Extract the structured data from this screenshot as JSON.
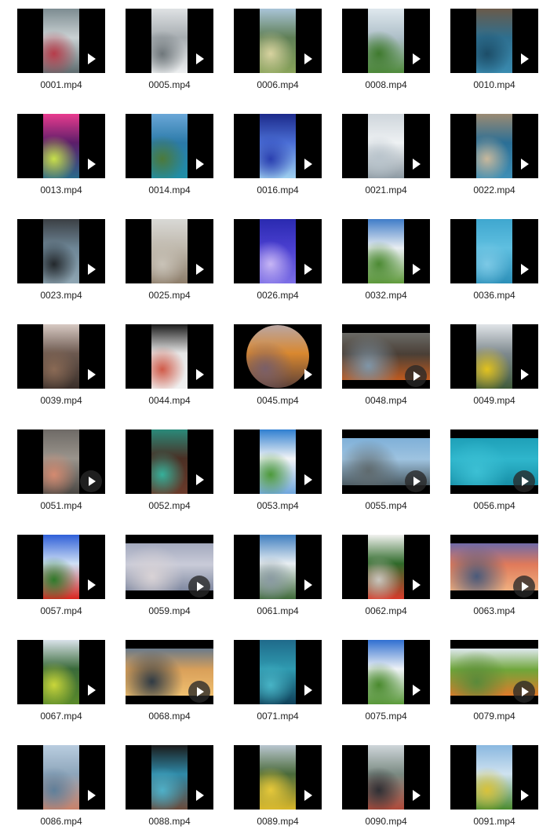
{
  "files": [
    {
      "name": "0001.mp4",
      "layout": "portrait",
      "play": "small",
      "colors": [
        "#7d8c91",
        "#c9d1d3",
        "#5e6b6e",
        "#b73c4a"
      ]
    },
    {
      "name": "0005.mp4",
      "layout": "portrait",
      "play": "small",
      "colors": [
        "#dfe2e4",
        "#a7adb1",
        "#eef0f1",
        "#6f777b"
      ]
    },
    {
      "name": "0006.mp4",
      "layout": "portrait",
      "play": "small",
      "colors": [
        "#a9c4d8",
        "#5f7f56",
        "#89a35a",
        "#d8d3a0"
      ]
    },
    {
      "name": "0008.mp4",
      "layout": "portrait",
      "play": "small",
      "colors": [
        "#dfe8ee",
        "#aebfc8",
        "#4f8a3b",
        "#3f7a2e"
      ]
    },
    {
      "name": "0010.mp4",
      "layout": "portrait",
      "play": "small",
      "colors": [
        "#6a5a4a",
        "#2e6f8f",
        "#3a8bb0",
        "#1c4d68"
      ]
    },
    {
      "name": "0013.mp4",
      "layout": "portrait",
      "play": "small",
      "colors": [
        "#e93b8f",
        "#5c1e6a",
        "#2a6a8a",
        "#c7e04a"
      ]
    },
    {
      "name": "0014.mp4",
      "layout": "portrait",
      "play": "small",
      "colors": [
        "#6aa7d8",
        "#2b7aa8",
        "#1f8fa6",
        "#4c7a3a"
      ]
    },
    {
      "name": "0016.mp4",
      "layout": "portrait",
      "play": "small",
      "colors": [
        "#1c2a8a",
        "#4b6fd6",
        "#9fd0ef",
        "#2a3fb0"
      ]
    },
    {
      "name": "0021.mp4",
      "layout": "portrait",
      "play": "small",
      "colors": [
        "#cfd6dc",
        "#eef1f3",
        "#8d9aa3",
        "#b9c4cc"
      ]
    },
    {
      "name": "0022.mp4",
      "layout": "portrait",
      "play": "small",
      "colors": [
        "#9a8a72",
        "#2b6f96",
        "#3e8fb6",
        "#c8b89c"
      ]
    },
    {
      "name": "0023.mp4",
      "layout": "portrait",
      "play": "small",
      "colors": [
        "#3b3f44",
        "#6e8696",
        "#8fa6b3",
        "#23282c"
      ]
    },
    {
      "name": "0025.mp4",
      "layout": "portrait",
      "play": "small",
      "colors": [
        "#d9d9d6",
        "#bfb8ac",
        "#8d7d6a",
        "#c9c3b8"
      ]
    },
    {
      "name": "0026.mp4",
      "layout": "portrait",
      "play": "small",
      "colors": [
        "#2a2ab0",
        "#4a3fd0",
        "#7d6fe6",
        "#c7b6f5"
      ]
    },
    {
      "name": "0032.mp4",
      "layout": "portrait",
      "play": "small",
      "colors": [
        "#3f7cc8",
        "#e9eef2",
        "#5f9a3b",
        "#4c8a33"
      ]
    },
    {
      "name": "0036.mp4",
      "layout": "portrait",
      "play": "small",
      "colors": [
        "#3fa7cf",
        "#5fbfe0",
        "#2c8fb8",
        "#7cc9e6"
      ]
    },
    {
      "name": "0039.mp4",
      "layout": "portrait",
      "play": "small",
      "colors": [
        "#d7c9c3",
        "#6d5a50",
        "#3a2f2a",
        "#8a6a55"
      ]
    },
    {
      "name": "0044.mp4",
      "layout": "portrait",
      "play": "small",
      "colors": [
        "#1a1a1a",
        "#e6e6e6",
        "#f0f0f0",
        "#d05a48"
      ]
    },
    {
      "name": "0045.mp4",
      "layout": "round",
      "play": "small",
      "colors": [
        "#b9a6a3",
        "#d9882f",
        "#5a3f38",
        "#7a5f68"
      ]
    },
    {
      "name": "0048.mp4",
      "layout": "landscape",
      "play": "circle",
      "colors": [
        "#6a6a66",
        "#4a3f36",
        "#c05a1e",
        "#7f96a8"
      ]
    },
    {
      "name": "0049.mp4",
      "layout": "portrait",
      "play": "small",
      "colors": [
        "#e0e4e8",
        "#7f8a8f",
        "#3f5a3a",
        "#e2c21e"
      ]
    },
    {
      "name": "0051.mp4",
      "layout": "portrait",
      "play": "circle",
      "colors": [
        "#6e6a66",
        "#9a948c",
        "#4a4743",
        "#d48a70"
      ]
    },
    {
      "name": "0052.mp4",
      "layout": "portrait",
      "play": "small",
      "colors": [
        "#2a8a7a",
        "#4a2f24",
        "#6a3a2a",
        "#36b09a"
      ]
    },
    {
      "name": "0053.mp4",
      "layout": "portrait",
      "play": "small",
      "colors": [
        "#2f7fd0",
        "#f2f4f6",
        "#6fa6dc",
        "#4d9a3a"
      ]
    },
    {
      "name": "0055.mp4",
      "layout": "landscape",
      "play": "circle",
      "colors": [
        "#7fb0d8",
        "#9ec3e0",
        "#4a5a62",
        "#5f6a6e"
      ]
    },
    {
      "name": "0056.mp4",
      "layout": "landscape",
      "play": "circle",
      "colors": [
        "#1fa0b8",
        "#2fb6cc",
        "#168ea6",
        "#3cc0d4"
      ]
    },
    {
      "name": "0057.mp4",
      "layout": "portrait",
      "play": "small",
      "colors": [
        "#2f5fd8",
        "#cfe0f5",
        "#d8261e",
        "#2f7a2a"
      ]
    },
    {
      "name": "0059.mp4",
      "layout": "landscape",
      "play": "circle",
      "colors": [
        "#a3a9bd",
        "#c9cbd8",
        "#7f88a0",
        "#d9d3d6"
      ]
    },
    {
      "name": "0061.mp4",
      "layout": "portrait",
      "play": "small",
      "colors": [
        "#3f7fc0",
        "#e8eef2",
        "#3f6a3a",
        "#8a9aa2"
      ]
    },
    {
      "name": "0062.mp4",
      "layout": "portrait",
      "play": "small",
      "colors": [
        "#f2f2f0",
        "#2f6a2a",
        "#d83a2a",
        "#c9c6be"
      ]
    },
    {
      "name": "0063.mp4",
      "layout": "landscape",
      "play": "circle",
      "colors": [
        "#6f6aa8",
        "#e07a5a",
        "#f0b080",
        "#4a5a7a"
      ]
    },
    {
      "name": "0067.mp4",
      "layout": "portrait",
      "play": "small",
      "colors": [
        "#d9e2ea",
        "#3a6a3a",
        "#5a8a2a",
        "#c9d63a"
      ]
    },
    {
      "name": "0068.mp4",
      "layout": "landscape",
      "play": "circle",
      "colors": [
        "#6a7a8a",
        "#d9a05a",
        "#f0c070",
        "#2f3a44"
      ]
    },
    {
      "name": "0071.mp4",
      "layout": "portrait",
      "play": "small",
      "colors": [
        "#1f6a8a",
        "#2f9ab0",
        "#0f3f58",
        "#48b4c6"
      ]
    },
    {
      "name": "0075.mp4",
      "layout": "portrait",
      "play": "small",
      "colors": [
        "#2f6fd0",
        "#eef2f6",
        "#5a9a3a",
        "#4a8a2e"
      ]
    },
    {
      "name": "0079.mp4",
      "layout": "landscape",
      "play": "circle",
      "colors": [
        "#dfe8ee",
        "#6fa63a",
        "#e07a2a",
        "#5a8a3a"
      ]
    },
    {
      "name": "0086.mp4",
      "layout": "portrait",
      "play": "small",
      "colors": [
        "#b9cde0",
        "#8ea6bb",
        "#c9826a",
        "#5f7f9a"
      ]
    },
    {
      "name": "0088.mp4",
      "layout": "portrait",
      "play": "small",
      "colors": [
        "#1a1a1a",
        "#2f8aa8",
        "#6a4a3a",
        "#4fb0c8"
      ]
    },
    {
      "name": "0089.mp4",
      "layout": "portrait",
      "play": "small",
      "colors": [
        "#b9c6d0",
        "#4a6a3a",
        "#d8b62a",
        "#e6c83a"
      ]
    },
    {
      "name": "0090.mp4",
      "layout": "portrait",
      "play": "small",
      "colors": [
        "#cfd6da",
        "#7a8a82",
        "#b04a3a",
        "#2f2f34"
      ]
    },
    {
      "name": "0091.mp4",
      "layout": "portrait",
      "play": "small",
      "colors": [
        "#8ab8e0",
        "#cfe2f0",
        "#4a8a2e",
        "#d8c23a"
      ]
    }
  ]
}
